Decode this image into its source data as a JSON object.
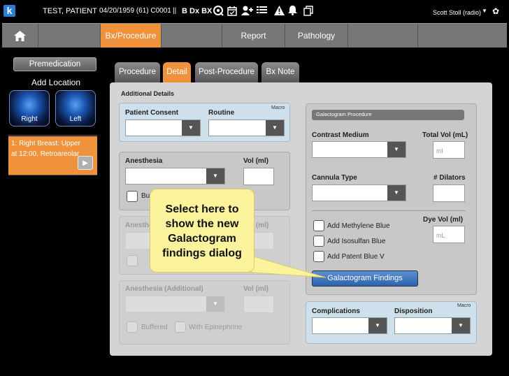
{
  "header": {
    "logo_letter": "k",
    "patient_name": "TEST, PATIENT",
    "patient_info": "04/20/1959 (61) C0001",
    "separator": "||",
    "codes": "B Dx BX",
    "user": "Scott Stoll (radio)",
    "icons": [
      "q-icon",
      "calendar-icon",
      "add-user-icon",
      "list-icon",
      "warning-icon",
      "bell-icon",
      "copy-icon",
      "chevron-down-icon",
      "gear-icon"
    ]
  },
  "nav": {
    "home_icon": "⌂",
    "items": [
      "Bx/Procedure",
      "Report",
      "Pathology"
    ]
  },
  "left": {
    "premed_label": "Premedication",
    "add_location": "Add Location",
    "right_label": "Right",
    "left_label": "Left",
    "location_item": "1: Right Breast: Upper at 12:00, Retroareolar"
  },
  "tabs": [
    "Procedure",
    "Detail",
    "Post-Procedure",
    "Bx Note"
  ],
  "details": {
    "title": "Additional Details",
    "consent_label": "Patient Consent",
    "routine_label": "Routine",
    "macro": "Macro",
    "anesthesia_label": "Anesthesia",
    "vol_label": "Vol (ml)",
    "buffered_short": "Bu",
    "anesthesia_short": "Anesthe",
    "vol_short": "(ml)",
    "anesthesia_add_label": "Anesthesia (Additional)",
    "vol2_label": "Vol (ml)",
    "buffered": "Buffered",
    "with_epi": "With Epinephrine"
  },
  "galacto": {
    "header": "Galactogram Procedure",
    "contrast_label": "Contrast Medium",
    "total_vol_label": "Total Vol (mL)",
    "total_vol_placeholder": "ml",
    "cannula_label": "Cannula Type",
    "dilators_label": "# Dilators",
    "dye_vol_label": "Dye Vol (ml)",
    "dye_vol_placeholder": "mL",
    "methylene": "Add Methylene Blue",
    "isosulfan": "Add Isosulfan Blue",
    "patent": "Add Patent Blue V",
    "findings_button": "Galactogram Findings"
  },
  "complications": {
    "complications_label": "Complications",
    "disposition_label": "Disposition",
    "macro": "Macro"
  },
  "callout": {
    "text": "Select here to show the new Galactogram findings dialog"
  },
  "colors": {
    "accent": "#f0923b",
    "blue_section": "#cde0ec",
    "button_blue": "#3f77c0",
    "callout": "#faf39c"
  }
}
